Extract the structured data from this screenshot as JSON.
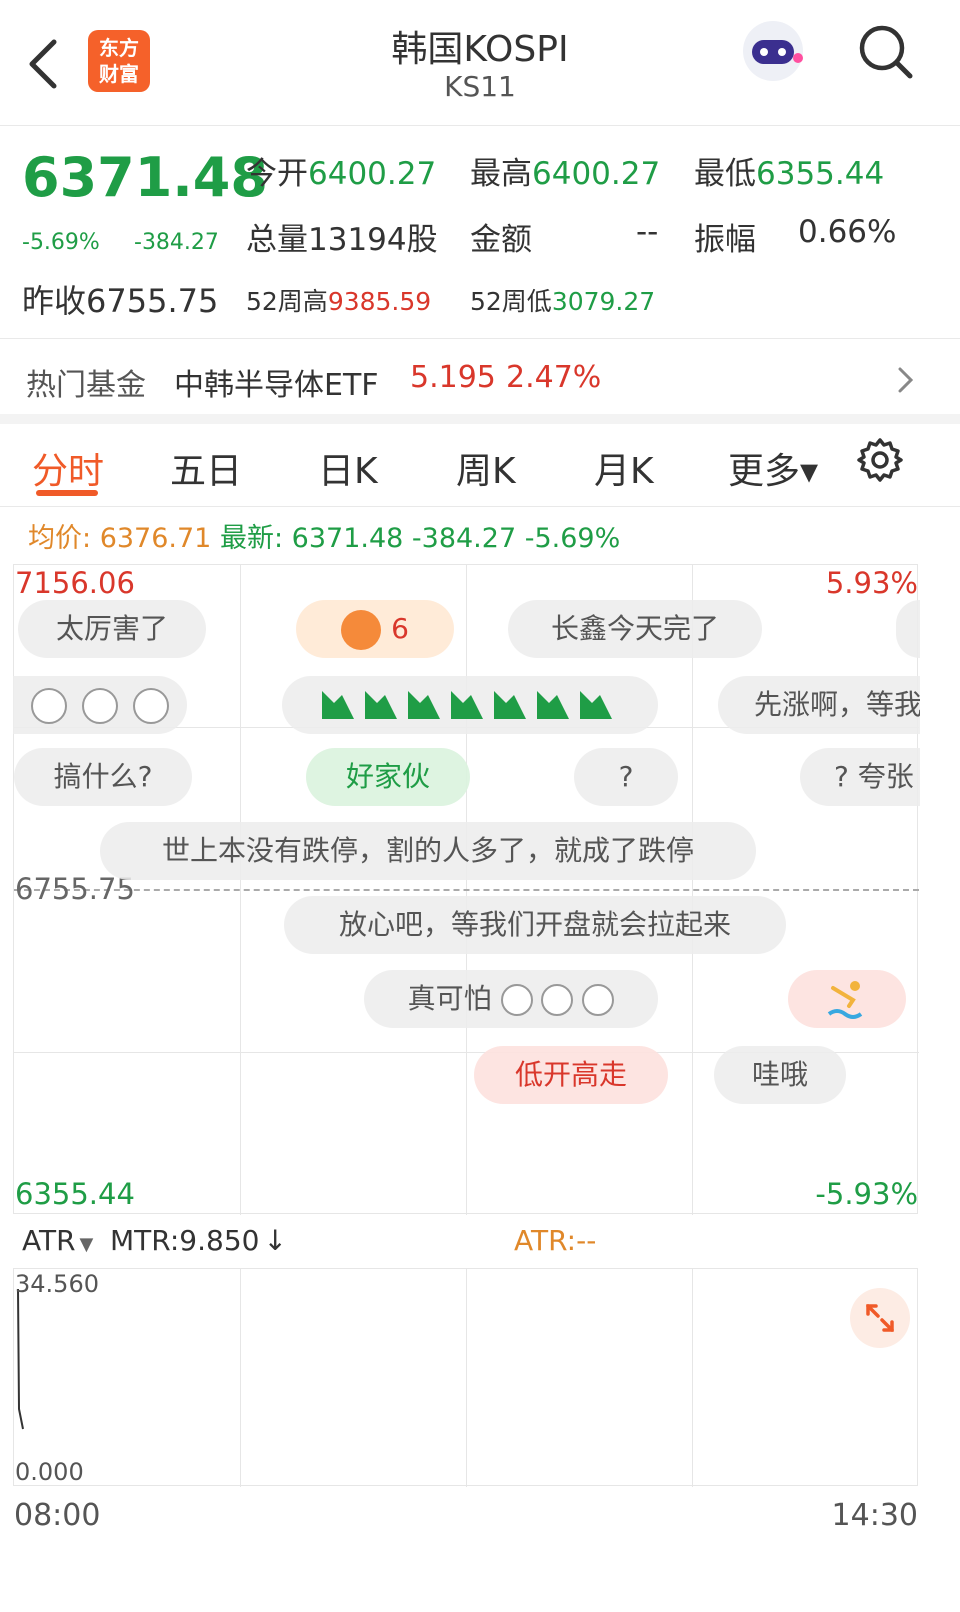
{
  "header": {
    "title": "韩国KOSPI",
    "code": "KS11",
    "logo_line1": "东方",
    "logo_line2": "财富"
  },
  "quote": {
    "price": "6371.48",
    "change_pct": "-5.69%",
    "change_abs": "-384.27",
    "prev_close_label": "昨收",
    "prev_close": "6755.75",
    "open_label": "今开",
    "open": "6400.27",
    "high_label": "最高",
    "high": "6400.27",
    "low_label": "最低",
    "low": "6355.44",
    "volume_label": "总量",
    "volume": "13194股",
    "amount_label": "金额",
    "amount": "--",
    "amplitude_label": "振幅",
    "amplitude": "0.66%",
    "wk52_high_label": "52周高",
    "wk52_high": "9385.59",
    "wk52_low_label": "52周低",
    "wk52_low": "3079.27"
  },
  "fund": {
    "label": "热门基金",
    "name": "中韩半导体ETF",
    "price": "5.195",
    "change": "2.47%"
  },
  "tabs": [
    {
      "label": "分时"
    },
    {
      "label": "五日"
    },
    {
      "label": "日K"
    },
    {
      "label": "周K"
    },
    {
      "label": "月K"
    },
    {
      "label": "更多▾"
    }
  ],
  "chart_info": {
    "avg_label": "均价:",
    "avg": "6376.71",
    "latest_label": "最新:",
    "latest": "6371.48",
    "latest_change": "-384.27",
    "latest_pct": "-5.69%"
  },
  "chart_axis": {
    "top_price": "7156.06",
    "top_pct": "5.93%",
    "mid_price": "6755.75",
    "bottom_price": "6355.44",
    "bottom_pct": "-5.93%"
  },
  "danmaku": {
    "b1": "太厉害了",
    "b2": "6",
    "b3": "长鑫今天完了",
    "b4": "先涨啊，等我",
    "b5": "搞什么?",
    "b6": "好家伙",
    "b7": "?",
    "b8": "?  夸张",
    "b9": "世上本没有跌停，割的人多了，就成了跌停",
    "b10": "放心吧，等我们开盘就会拉起来",
    "b11": "真可怕",
    "b12": "低开高走",
    "b13": "哇哦"
  },
  "indicator": {
    "name": "ATR",
    "mtr": "MTR:9.850",
    "atr": "ATR:--",
    "top": "34.560",
    "bottom": "0.000"
  },
  "time_axis": {
    "start": "08:00",
    "end": "14:30"
  },
  "colors": {
    "up": "#d9372b",
    "down": "#1f9d46",
    "accent": "#f05a28"
  }
}
